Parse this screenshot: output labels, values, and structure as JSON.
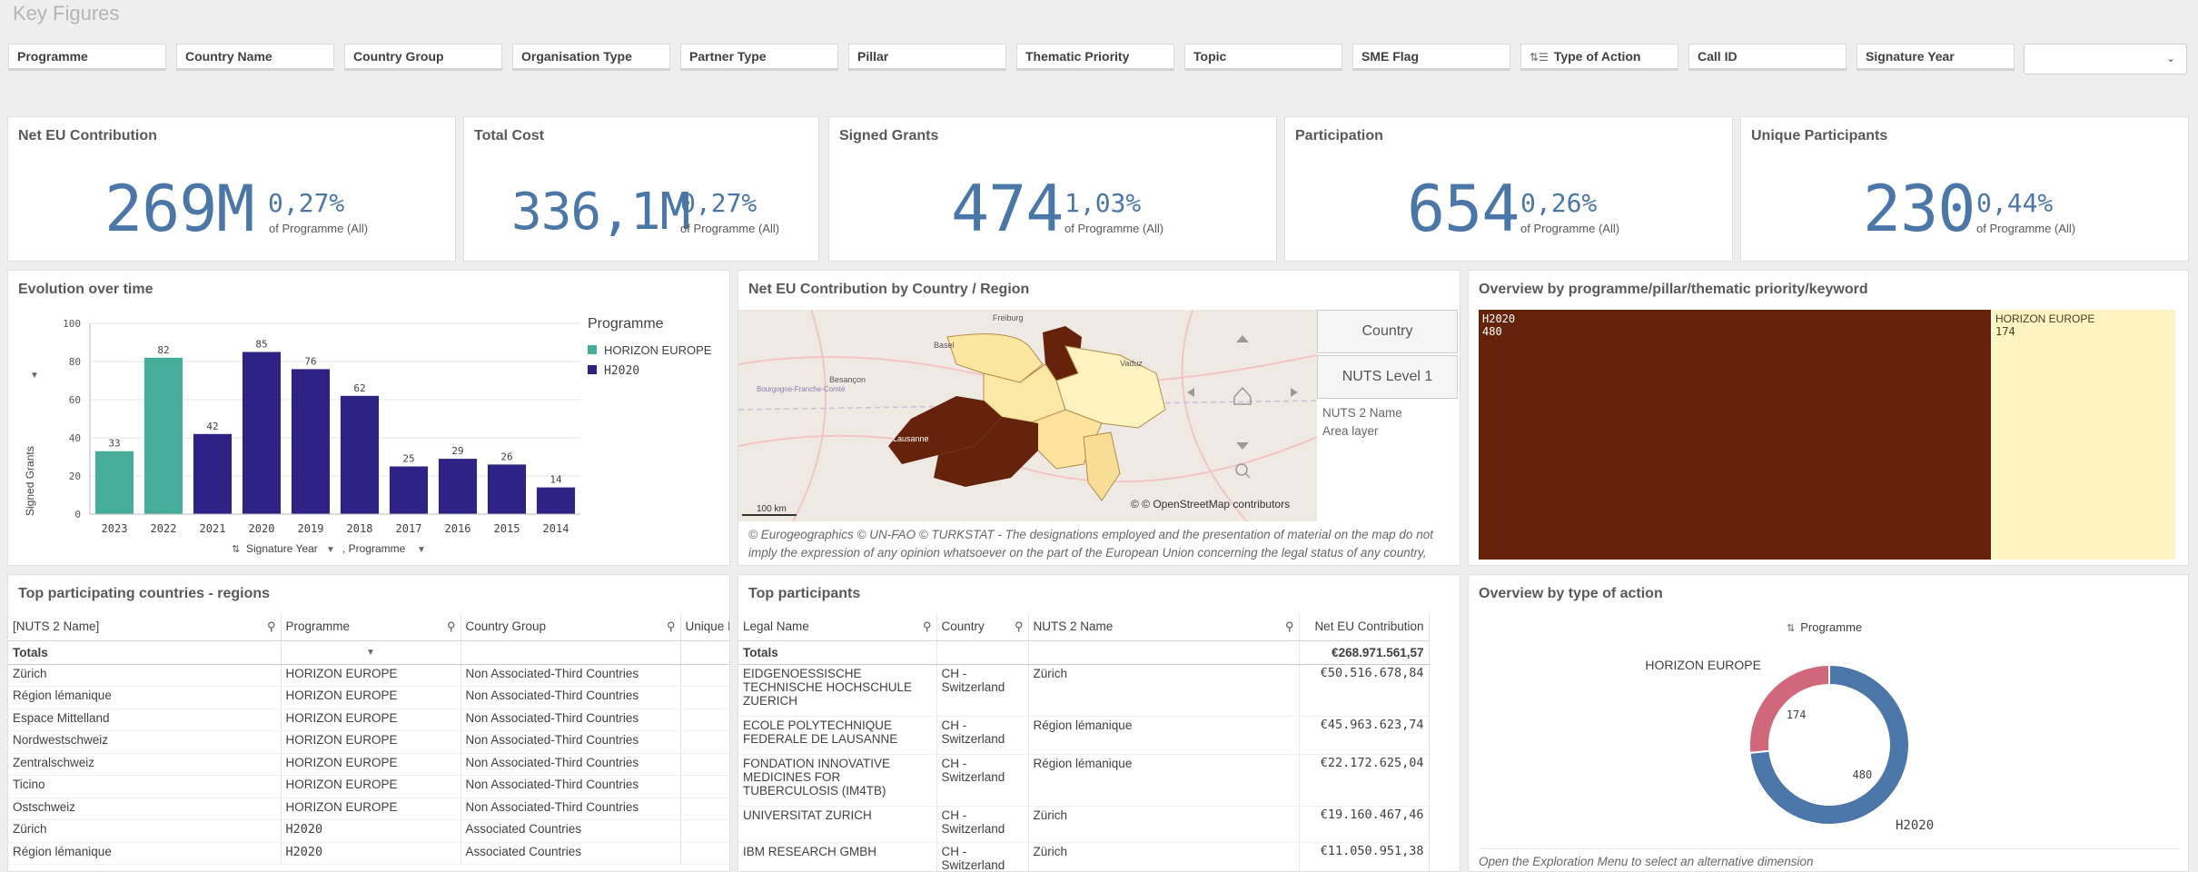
{
  "app_title": "Key Figures",
  "filters": [
    {
      "label": "Programme"
    },
    {
      "label": "Country Name"
    },
    {
      "label": "Country Group"
    },
    {
      "label": "Organisation Type"
    },
    {
      "label": "Partner Type"
    },
    {
      "label": "Pillar"
    },
    {
      "label": "Thematic Priority"
    },
    {
      "label": "Topic"
    },
    {
      "label": "SME Flag"
    },
    {
      "label": "Type of Action",
      "icon": "sort-icon"
    },
    {
      "label": "Call ID"
    },
    {
      "label": "Signature Year"
    }
  ],
  "kpis": [
    {
      "title": "Net EU Contribution",
      "value": "269M",
      "pct": "0,27%",
      "sub": "of Programme (All)"
    },
    {
      "title": "Total Cost",
      "value": "336,1M",
      "pct": "0,27%",
      "sub": "of Programme (All)"
    },
    {
      "title": "Signed Grants",
      "value": "474",
      "pct": "1,03%",
      "sub": "of Programme (All)"
    },
    {
      "title": "Participation",
      "value": "654",
      "pct": "0,26%",
      "sub": "of Programme (All)"
    },
    {
      "title": "Unique Participants",
      "value": "230",
      "pct": "0,44%",
      "sub": "of Programme (All)"
    }
  ],
  "evolution": {
    "title": "Evolution over time",
    "legend_title": "Programme",
    "x_footer": "Signature Year",
    "x_footer2": ", Programme",
    "colors": {
      "HORIZON EUROPE": "#45ad9a",
      "H2020": "#2e2385"
    }
  },
  "chart_data": {
    "type": "bar",
    "categories": [
      "2023",
      "2022",
      "2021",
      "2020",
      "2019",
      "2018",
      "2017",
      "2016",
      "2015",
      "2014"
    ],
    "values": [
      33,
      82,
      42,
      85,
      76,
      62,
      25,
      29,
      26,
      14
    ],
    "series_of_bar": [
      "HORIZON EUROPE",
      "HORIZON EUROPE",
      "H2020",
      "H2020",
      "H2020",
      "H2020",
      "H2020",
      "H2020",
      "H2020",
      "H2020"
    ],
    "legend": [
      "HORIZON EUROPE",
      "H2020"
    ],
    "ylabel": "Signed Grants",
    "ylim": [
      0,
      100
    ],
    "yticks": [
      0,
      20,
      40,
      60,
      80,
      100
    ],
    "grid": true,
    "legend_position": "right"
  },
  "map": {
    "title": "Net EU Contribution by Country / Region",
    "btn_country": "Country",
    "btn_nuts": "NUTS Level 1",
    "layer_name": "NUTS 2 Name",
    "layer_type": "Area layer",
    "scale": "100 km",
    "attribution": "© © OpenStreetMap contributors",
    "place_labels": [
      "Freiburg",
      "Basel",
      "Besançon",
      "Bourgogne-Franche-Comté",
      "Vaduz",
      "Lausanne"
    ],
    "footnote": "© Eurogeographics © UN-FAO © TURKSTAT - The designations employed and the presentation of material on the map do not imply the expression of any opinion whatsoever on the part of the European Union concerning the legal status of any country, territory or"
  },
  "treemap": {
    "title": "Overview by programme/pillar/thematic priority/keyword",
    "items": [
      {
        "name": "H2020",
        "value": "480",
        "color": "#66230b"
      },
      {
        "name": "HORIZON EUROPE",
        "value": "174",
        "color": "#fff5c2"
      }
    ]
  },
  "countries": {
    "title": "Top participating countries - regions",
    "headers": [
      "[NUTS 2 Name]",
      "Programme",
      "Country Group",
      "Unique I"
    ],
    "totals_label": "Totals",
    "rows": [
      [
        "Zürich",
        "HORIZON EUROPE",
        "Non Associated-Third Countries"
      ],
      [
        "Région lémanique",
        "HORIZON EUROPE",
        "Non Associated-Third Countries"
      ],
      [
        "Espace Mittelland",
        "HORIZON EUROPE",
        "Non Associated-Third Countries"
      ],
      [
        "Nordwestschweiz",
        "HORIZON EUROPE",
        "Non Associated-Third Countries"
      ],
      [
        "Zentralschweiz",
        "HORIZON EUROPE",
        "Non Associated-Third Countries"
      ],
      [
        "Ticino",
        "HORIZON EUROPE",
        "Non Associated-Third Countries"
      ],
      [
        "Ostschweiz",
        "HORIZON EUROPE",
        "Non Associated-Third Countries"
      ],
      [
        "Zürich",
        "H2020",
        "Associated Countries"
      ],
      [
        "Région lémanique",
        "H2020",
        "Associated Countries"
      ]
    ]
  },
  "participants": {
    "title": "Top participants",
    "headers": [
      "Legal Name",
      "Country",
      "NUTS 2 Name",
      "Net EU Contribution"
    ],
    "totals_label": "Totals",
    "total_value": "€268.971.561,57",
    "rows": [
      [
        "EIDGENOESSISCHE TECHNISCHE HOCHSCHULE ZUERICH",
        "CH - Switzerland",
        "Zürich",
        "€50.516.678,84"
      ],
      [
        "ECOLE POLYTECHNIQUE FEDERALE DE LAUSANNE",
        "CH - Switzerland",
        "Région lémanique",
        "€45.963.623,74"
      ],
      [
        "FONDATION INNOVATIVE MEDICINES FOR TUBERCULOSIS (IM4TB)",
        "CH - Switzerland",
        "Région lémanique",
        "€22.172.625,04"
      ],
      [
        "UNIVERSITAT ZURICH",
        "CH - Switzerland",
        "Zürich",
        "€19.160.467,46"
      ],
      [
        "IBM RESEARCH GMBH",
        "CH - Switzerland",
        "Zürich",
        "€11.050.951,38"
      ]
    ]
  },
  "donut": {
    "title": "Overview by type of action",
    "legend_label": "Programme",
    "slices": [
      {
        "name": "HORIZON EUROPE",
        "value": 174,
        "color": "#d0677a"
      },
      {
        "name": "H2020",
        "value": 480,
        "color": "#4a76a8"
      }
    ],
    "hint": "Open the Exploration Menu to select an alternative dimension"
  }
}
